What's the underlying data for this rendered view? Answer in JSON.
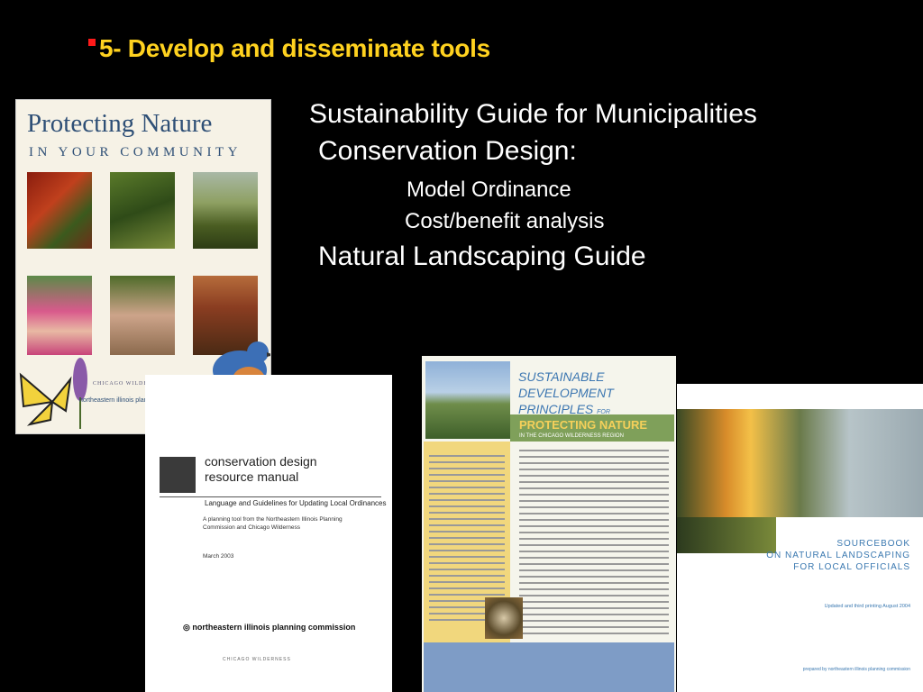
{
  "slide": {
    "title": "5- Develop and disseminate tools",
    "lines": [
      "Sustainability Guide for  Municipalities",
      "Conservation Design:",
      "Model Ordinance",
      "Cost/benefit analysis",
      "Natural Landscaping Guide"
    ]
  },
  "covers": {
    "protecting_nature": {
      "title": "Protecting Nature",
      "subtitle": "IN YOUR COMMUNITY",
      "publisher": "northeastern illinois planning commission",
      "partner": "CHICAGO WILDERNESS"
    },
    "conservation_design": {
      "title_line1": "conservation design",
      "title_line2": "resource manual",
      "subtitle": "Language and Guidelines for Updating Local Ordinances",
      "description_line1": "A planning tool from the Northeastern Illinois Planning",
      "description_line2": "Commission and Chicago Wilderness",
      "date": "March 2003",
      "publisher": "northeastern illinois planning commission",
      "partner": "CHICAGO WILDERNESS"
    },
    "sustainable_principles": {
      "heading_line1": "SUSTAINABLE",
      "heading_line2": "DEVELOPMENT",
      "heading_line3": "PRINCIPLES",
      "heading_for": "FOR",
      "band_title": "PROTECTING NATURE",
      "band_subtitle": "IN THE CHICAGO WILDERNESS REGION"
    },
    "sourcebook": {
      "title_line1": "SOURCEBOOK",
      "title_line2": "ON NATURAL LANDSCAPING",
      "title_line3": "FOR LOCAL OFFICIALS",
      "note": "Updated and third printing August 2004",
      "prepared_by": "prepared by  northeastern illinois planning commission"
    }
  },
  "colors": {
    "background": "#000000",
    "title": "#ffd21f",
    "bullet": "#ff1a1a",
    "body_text": "#ffffff"
  }
}
